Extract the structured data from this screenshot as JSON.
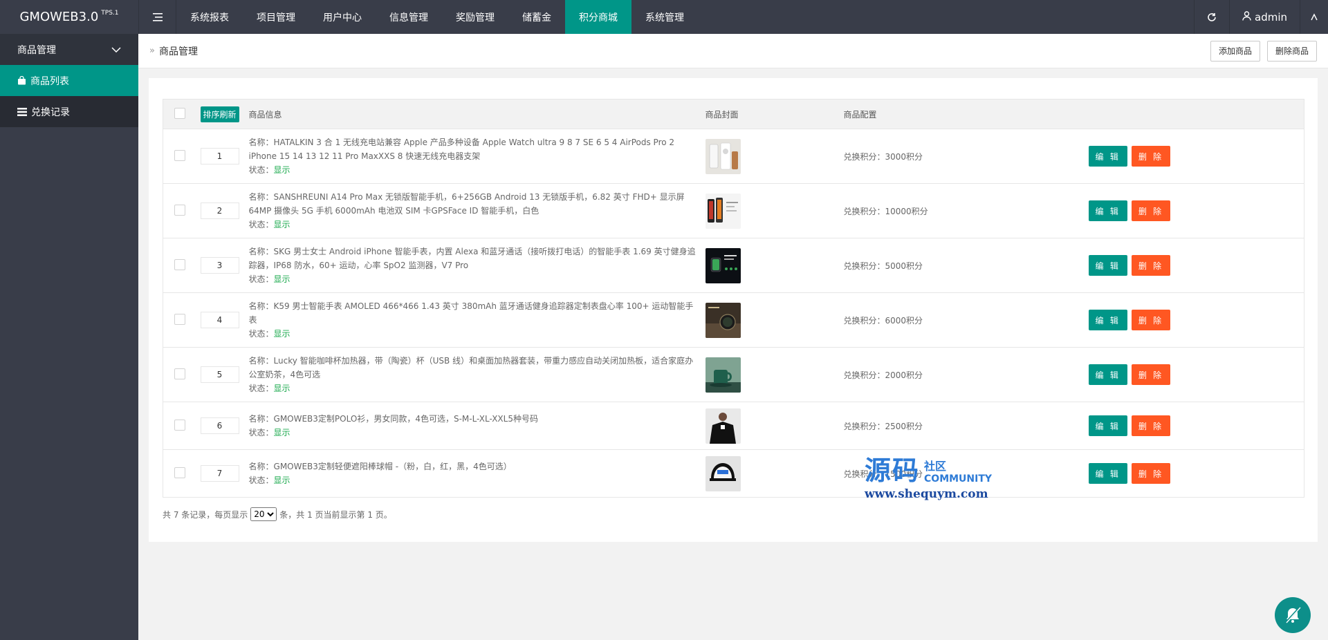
{
  "brand": {
    "name": "GMOWEB3.0",
    "version": "TPS.1"
  },
  "nav": [
    {
      "label": "系统报表"
    },
    {
      "label": "项目管理"
    },
    {
      "label": "用户中心"
    },
    {
      "label": "信息管理"
    },
    {
      "label": "奖励管理"
    },
    {
      "label": "储蓄金"
    },
    {
      "label": "积分商城",
      "active": true
    },
    {
      "label": "系统管理"
    }
  ],
  "user": {
    "name": "admin"
  },
  "sidebar": {
    "group_label": "商品管理",
    "items": [
      {
        "label": "商品列表",
        "icon": "bag-icon",
        "active": true
      },
      {
        "label": "兑换记录",
        "icon": "list-icon"
      }
    ]
  },
  "breadcrumb": {
    "label": "商品管理"
  },
  "actions": {
    "add_label": "添加商品",
    "delete_label": "删除商品"
  },
  "table": {
    "sort_refresh_label": "排序刷新",
    "headers": {
      "info": "商品信息",
      "cover": "商品封面",
      "config": "商品配置"
    },
    "name_prefix": "名称：",
    "status_prefix": "状态：",
    "edit_label": "编 辑",
    "delete_label": "删 除",
    "rows": [
      {
        "sort": "1",
        "name": "HATALKIN 3 合 1 无线充电站兼容 Apple 产品多种设备 Apple Watch ultra 9 8 7 SE 6 5 4 AirPods Pro 2 iPhone 15 14 13 12 11 Pro MaxXXS 8 快速无线充电器支架",
        "status": "显示",
        "config": "兑换积分：3000积分"
      },
      {
        "sort": "2",
        "name": "SANSHREUNI A14 Pro Max 无锁版智能手机，6+256GB Android 13 无锁版手机，6.82 英寸 FHD+ 显示屏 64MP 摄像头 5G 手机 6000mAh 电池双 SIM 卡GPSFace ID 智能手机，白色",
        "status": "显示",
        "config": "兑换积分：10000积分"
      },
      {
        "sort": "3",
        "name": "SKG 男士女士 Android iPhone 智能手表，内置 Alexa 和蓝牙通话（接听拨打电话）的智能手表 1.69 英寸健身追踪器，IP68 防水，60+ 运动，心率 SpO2 监测器，V7 Pro",
        "status": "显示",
        "config": "兑换积分：5000积分"
      },
      {
        "sort": "4",
        "name": "K59 男士智能手表 AMOLED 466*466 1.43 英寸 380mAh 蓝牙通话健身追踪器定制表盘心率 100+ 运动智能手表",
        "status": "显示",
        "config": "兑换积分：6000积分"
      },
      {
        "sort": "5",
        "name": "Lucky 智能咖啡杯加热器，带（陶瓷）杯（USB 线）和桌面加热器套装，带重力感应自动关闭加热板，适合家庭办公室奶茶，4色可选",
        "status": "显示",
        "config": "兑换积分：2000积分"
      },
      {
        "sort": "6",
        "name": "GMOWEB3定制POLO衫，男女同款，4色可选，S-M-L-XL-XXL5种号码",
        "status": "显示",
        "config": "兑换积分：2500积分"
      },
      {
        "sort": "7",
        "name": "GMOWEB3定制轻便遮阳棒球帽 -（粉，白，红，黑，4色可选）",
        "status": "显示",
        "config": "兑换积分：1500积分"
      }
    ]
  },
  "pager": {
    "prefix": "共 7 条记录，每页显示",
    "page_size": "20",
    "suffix": "条，共 1 页当前显示第 1 页。"
  },
  "watermark": {
    "big": "源码",
    "small": "社区",
    "community": "COMMUNITY",
    "url": "www.shequym.com"
  },
  "colors": {
    "accent": "#009688",
    "danger": "#ff5722",
    "header": "#393d49",
    "status": "#1aa94c"
  }
}
